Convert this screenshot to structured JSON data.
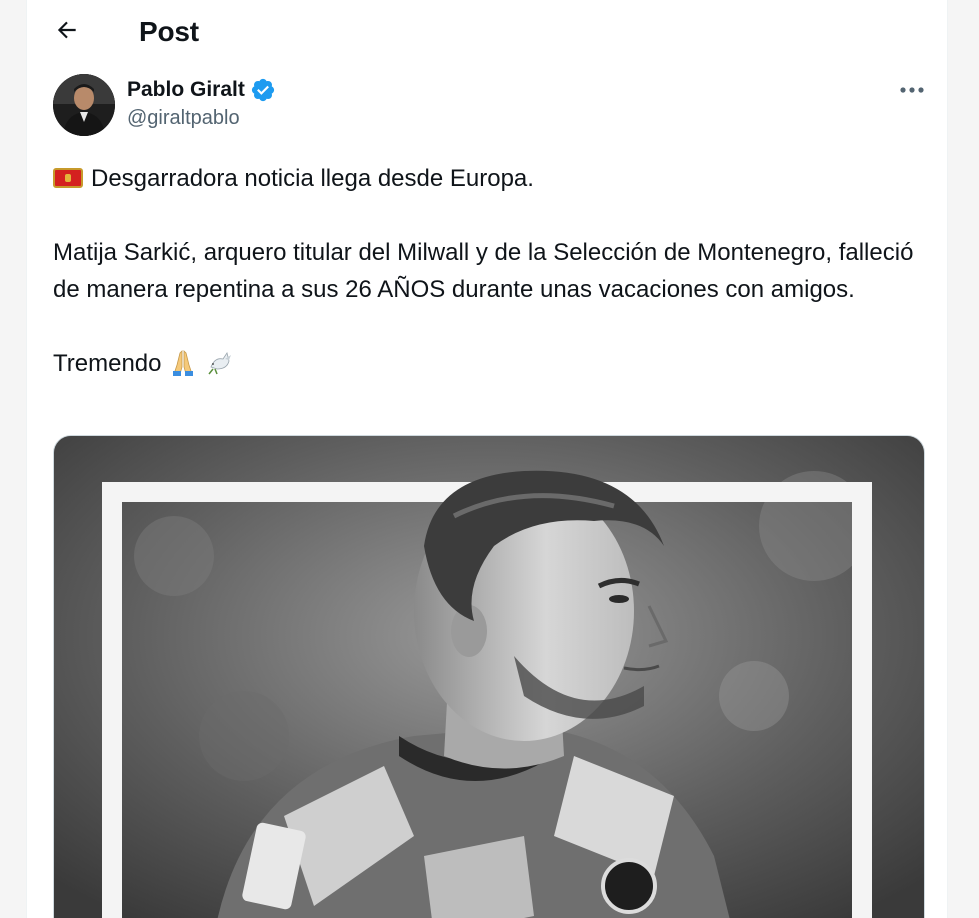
{
  "header": {
    "title": "Post",
    "back_icon": "arrow-left-icon"
  },
  "author": {
    "display_name": "Pablo Giralt",
    "handle": "@giraltpablo",
    "verified": true,
    "verified_color": "#1d9bf0",
    "avatar_icon": "avatar-photo"
  },
  "tweet": {
    "line1": "Desgarradora noticia llega desde Europa.",
    "line2": "Matija Sarkić, arquero titular del Milwall y de la Selección de Montenegro, falleció de manera repentina a sus 26 AÑOS durante unas vacaciones con amigos.",
    "line3": "Tremendo",
    "flag_icon": "montenegro-flag-icon",
    "emojis": [
      "folded-hands-icon",
      "dove-icon"
    ]
  },
  "media": {
    "type": "photo",
    "style": "black-and-white"
  },
  "colors": {
    "text": "#0f1419",
    "secondary": "#536471",
    "accent": "#1d9bf0"
  }
}
